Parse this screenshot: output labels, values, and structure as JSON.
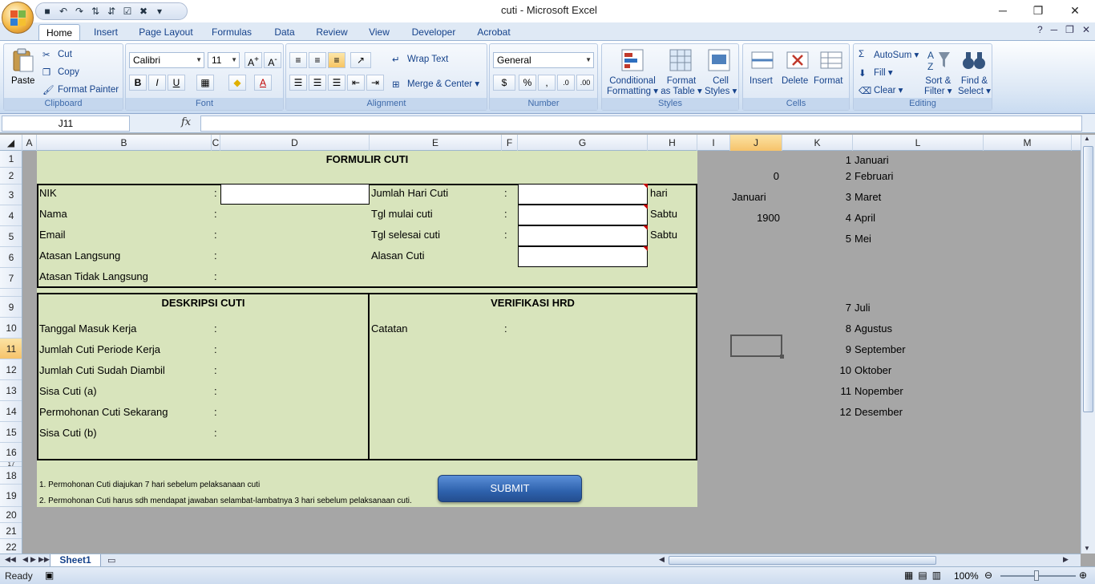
{
  "window": {
    "title": "cuti - Microsoft Excel"
  },
  "tabs": [
    "Home",
    "Insert",
    "Page Layout",
    "Formulas",
    "Data",
    "Review",
    "View",
    "Developer",
    "Acrobat"
  ],
  "ribbon": {
    "clipboard": {
      "label": "Clipboard",
      "paste": "Paste",
      "cut": "Cut",
      "copy": "Copy",
      "format_painter": "Format Painter"
    },
    "font": {
      "label": "Font",
      "name": "Calibri",
      "size": "11"
    },
    "alignment": {
      "label": "Alignment",
      "wrap": "Wrap Text",
      "merge": "Merge & Center"
    },
    "number": {
      "label": "Number",
      "format": "General"
    },
    "styles": {
      "label": "Styles",
      "conditional": "Conditional",
      "conditional2": "Formatting",
      "format_as": "Format",
      "format_as2": "as Table",
      "cell": "Cell",
      "cell2": "Styles"
    },
    "cells": {
      "label": "Cells",
      "insert": "Insert",
      "delete": "Delete",
      "format": "Format"
    },
    "editing": {
      "label": "Editing",
      "autosum": "AutoSum",
      "fill": "Fill",
      "clear": "Clear",
      "sort": "Sort &",
      "sort2": "Filter",
      "find": "Find &",
      "find2": "Select"
    }
  },
  "formula_bar": {
    "name_box": "J11",
    "fx": "fx",
    "content": ""
  },
  "columns": [
    "A",
    "B",
    "C",
    "D",
    "E",
    "F",
    "G",
    "H",
    "I",
    "J",
    "K",
    "L",
    "M"
  ],
  "rows": [
    "1",
    "2",
    "3",
    "4",
    "5",
    "6",
    "7",
    "9",
    "10",
    "11",
    "12",
    "13",
    "14",
    "15",
    "16",
    "17",
    "18",
    "19",
    "20",
    "21",
    "22"
  ],
  "form": {
    "title": "FORMULIR CUTI",
    "left_fields": [
      "NIK",
      "Nama",
      "Email",
      "Atasan Langsung",
      "Atasan Tidak Langsung"
    ],
    "right_fields": [
      "Jumlah Hari Cuti",
      "Tgl mulai cuti",
      "Tgl selesai cuti",
      "Alasan Cuti"
    ],
    "colon": ":",
    "unit_hari": "hari",
    "day1": "Sabtu",
    "day2": "Sabtu",
    "desc_title": "DESKRIPSI CUTI",
    "desc_fields": [
      "Tanggal Masuk Kerja",
      "Jumlah Cuti Periode Kerja",
      "Jumlah Cuti Sudah Diambil",
      "Sisa Cuti (a)",
      "Permohonan Cuti Sekarang",
      "Sisa Cuti (b)"
    ],
    "hrd_title": "VERIFIKASI HRD",
    "hrd_note": "Catatan",
    "note1": "1. Permohonan Cuti diajukan 7 hari sebelum pelaksanaan cuti",
    "note2": "2. Permohonan Cuti harus sdh mendapat jawaban selambat-lambatnya 3 hari sebelum pelaksanaan cuti.",
    "submit": "SUBMIT"
  },
  "side": {
    "j2": "0",
    "j3": "Januari",
    "j4": "1900",
    "months": [
      {
        "n": "1",
        "m": "Januari"
      },
      {
        "n": "2",
        "m": "Februari"
      },
      {
        "n": "3",
        "m": "Maret"
      },
      {
        "n": "4",
        "m": "April"
      },
      {
        "n": "5",
        "m": "Mei"
      },
      {
        "n": "7",
        "m": "Juli"
      },
      {
        "n": "8",
        "m": "Agustus"
      },
      {
        "n": "9",
        "m": "September"
      },
      {
        "n": "10",
        "m": "Oktober"
      },
      {
        "n": "11",
        "m": "Nopember"
      },
      {
        "n": "12",
        "m": "Desember"
      }
    ]
  },
  "sheet_tab": "Sheet1",
  "status": {
    "ready": "Ready",
    "zoom": "100%"
  }
}
